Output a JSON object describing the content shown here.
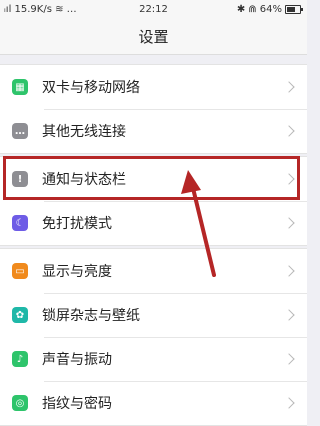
{
  "status_bar": {
    "signal": "ዖ ",
    "left_text": "独 15.9K/s ≈ …",
    "time": "22:12",
    "right_text": "✱ Ⓜ 64%",
    "battery_level": 0.64
  },
  "header": {
    "title": "设置"
  },
  "groups": [
    {
      "items": [
        {
          "label": "双卡与移动网络",
          "icon": "sim-icon",
          "color": "#2ec46b",
          "glyph": "▦"
        },
        {
          "label": "其他无线连接",
          "icon": "more-icon",
          "color": "#8e8e93",
          "glyph": "…"
        }
      ]
    },
    {
      "items": [
        {
          "label": "通知与状态栏",
          "icon": "notification-icon",
          "color": "#8e8e93",
          "glyph": "!"
        },
        {
          "label": "免打扰模式",
          "icon": "moon-icon",
          "color": "#6e5ce6",
          "glyph": "☾"
        }
      ]
    },
    {
      "items": [
        {
          "label": "显示与亮度",
          "icon": "display-icon",
          "color": "#f08a1d",
          "glyph": "▭"
        },
        {
          "label": "锁屏杂志与壁纸",
          "icon": "flower-icon",
          "color": "#1fb8a8",
          "glyph": "✿"
        },
        {
          "label": "声音与振动",
          "icon": "sound-icon",
          "color": "#2ec46b",
          "glyph": "♪"
        },
        {
          "label": "指纹与密码",
          "icon": "fingerprint-icon",
          "color": "#2ec46b",
          "glyph": "◎"
        }
      ]
    }
  ],
  "annotation_color": "#b52626"
}
